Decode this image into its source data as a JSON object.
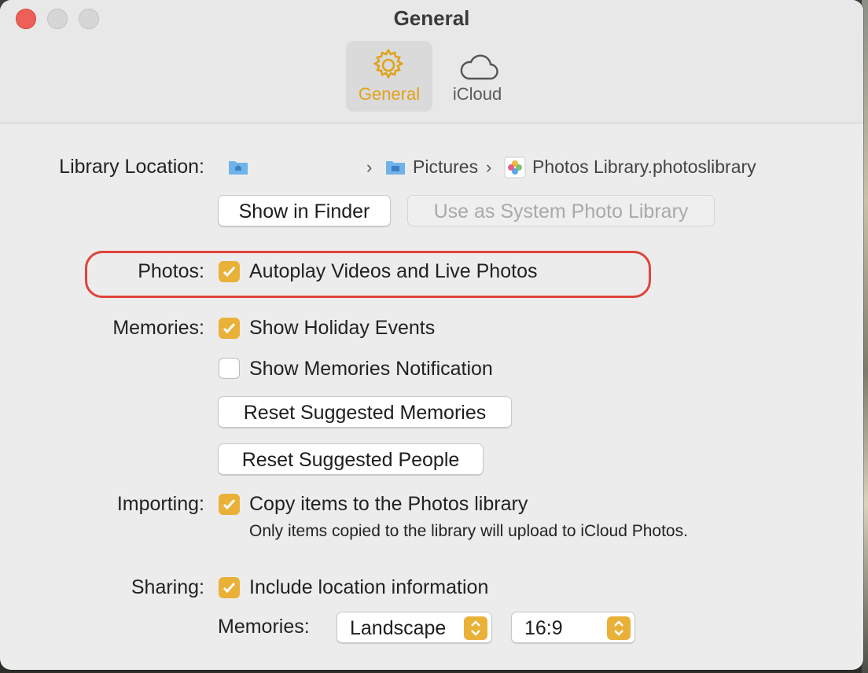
{
  "window": {
    "title": "General"
  },
  "toolbar": {
    "tabs": [
      {
        "label": "General",
        "icon": "gear-icon",
        "selected": true
      },
      {
        "label": "iCloud",
        "icon": "cloud-icon",
        "selected": false
      }
    ]
  },
  "library": {
    "label": "Library Location:",
    "path": [
      {
        "icon": "home-folder-icon"
      },
      {
        "label": "Pictures",
        "icon": "pictures-folder-icon"
      },
      {
        "label": "Photos Library.photoslibrary",
        "icon": "photos-library-icon"
      }
    ],
    "show_in_finder": "Show in Finder",
    "use_as_system": "Use as System Photo Library"
  },
  "photos": {
    "label": "Photos:",
    "autoplay": {
      "label": "Autoplay Videos and Live Photos",
      "checked": true
    }
  },
  "memories": {
    "label": "Memories:",
    "holiday": {
      "label": "Show Holiday Events",
      "checked": true
    },
    "notification": {
      "label": "Show Memories Notification",
      "checked": false
    },
    "reset_memories": "Reset Suggested Memories",
    "reset_people": "Reset Suggested People"
  },
  "importing": {
    "label": "Importing:",
    "copy": {
      "label": "Copy items to the Photos library",
      "checked": true
    },
    "note": "Only items copied to the library will upload to iCloud Photos."
  },
  "sharing": {
    "label": "Sharing:",
    "location": {
      "label": "Include location information",
      "checked": true
    },
    "memories_label": "Memories:",
    "orientation": "Landscape",
    "aspect": "16:9"
  },
  "colors": {
    "accent": "#eab139",
    "close": "#ee5f57",
    "highlight": "#e0443a"
  }
}
